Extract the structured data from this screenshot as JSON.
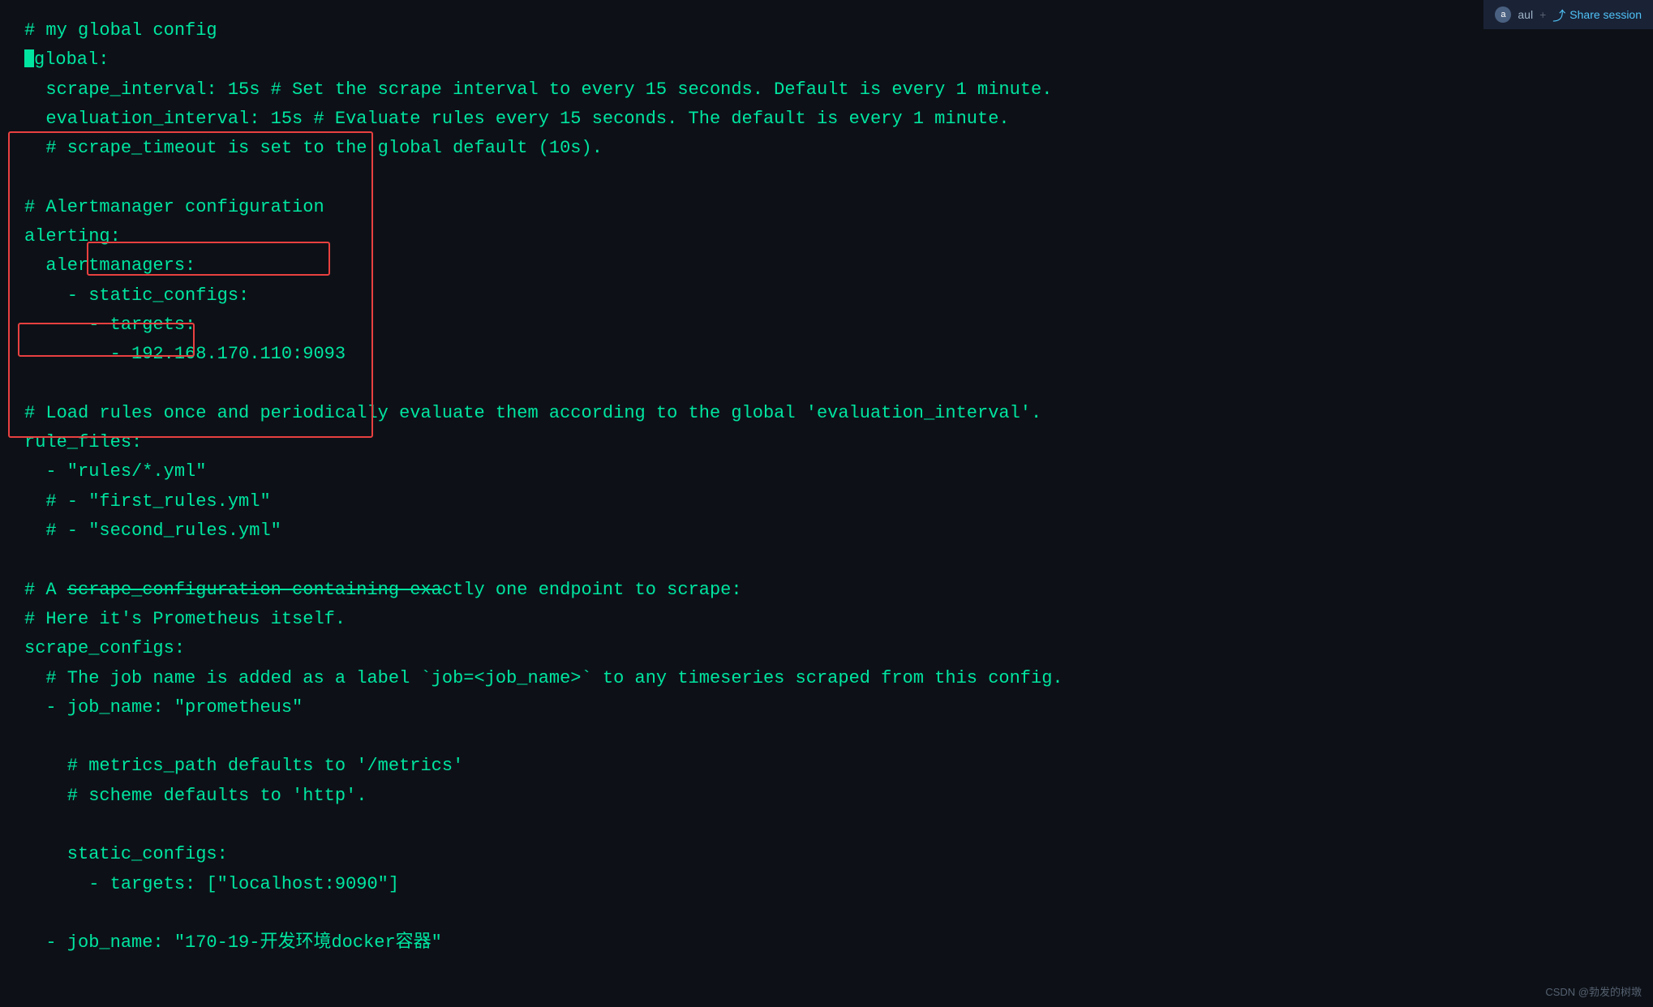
{
  "topbar": {
    "user": "aul",
    "share_label": "Share session"
  },
  "watermark": "CSDN @勃发的树墩",
  "code": {
    "lines": [
      "# my global config",
      "global:",
      "  scrape_interval: 15s # Set the scrape interval to every 15 seconds. Default is every 1 minute.",
      "  evaluation_interval: 15s # Evaluate rules every 15 seconds. The default is every 1 minute.",
      "  # scrape_timeout is set to the global default (10s).",
      "",
      "# Alertmanager configuration",
      "alerting:",
      "  alertmanagers:",
      "    - static_configs:",
      "      - targets:",
      "        - 192.168.170.110:9093",
      "",
      "# Load rules once and periodically evaluate them according to the global 'evaluation_interval'.",
      "rule_files:",
      "  - \"rules/*.yml\"",
      "  # - \"first_rules.yml\"",
      "  # - \"second_rules.yml\"",
      "",
      "# A scrape_configuration containing exactly one endpoint to scrape:",
      "# Here it's Prometheus itself.",
      "scrape_configs:",
      "  # The job name is added as a label `job=<job_name>` to any timeseries scraped from this config.",
      "  - job_name: \"prometheus\"",
      "",
      "    # metrics_path defaults to '/metrics'",
      "    # scheme defaults to 'http'.",
      "",
      "    static_configs:",
      "      - targets: [\"localhost:9090\"]",
      "",
      "  - job_name: \"170-19-开发环境docker容器\""
    ]
  }
}
